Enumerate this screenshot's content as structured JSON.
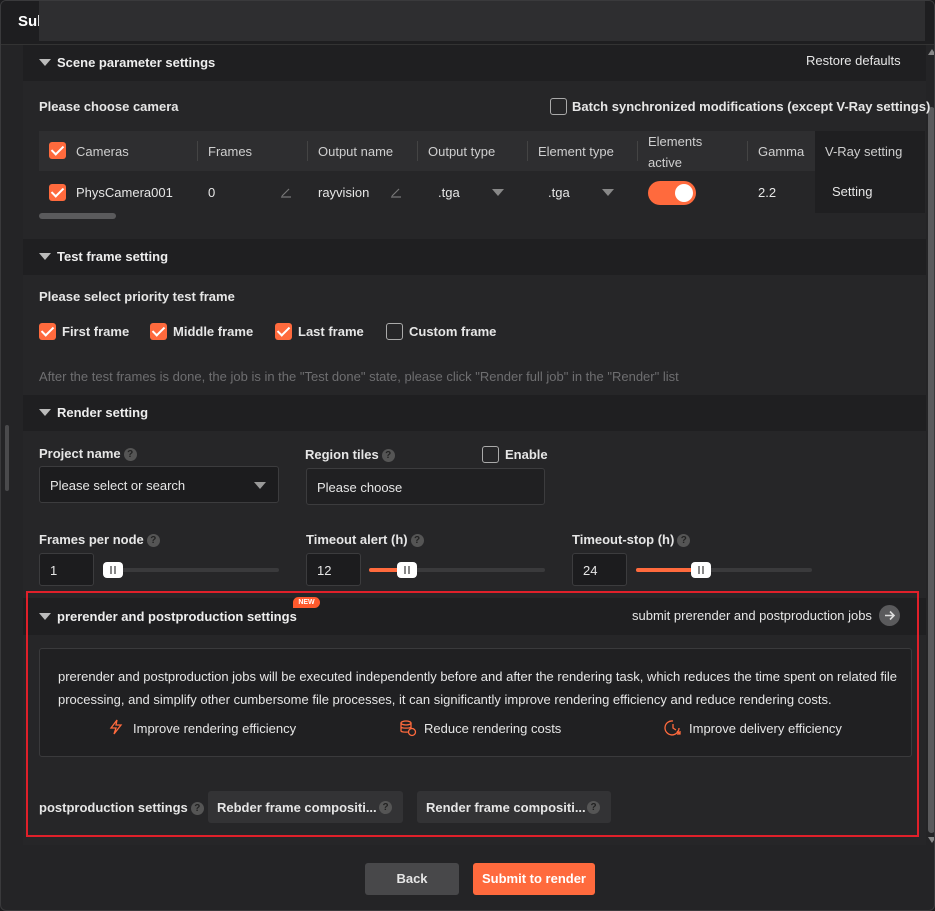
{
  "dialog": {
    "title": "Submit to render"
  },
  "scene": {
    "header": "Scene parameter settings",
    "restore_defaults": "Restore defaults",
    "choose_camera": "Please choose camera",
    "batch_label": "Batch synchronized modifications (except V-Ray settings)",
    "columns": {
      "cameras": "Cameras",
      "frames": "Frames",
      "output_name": "Output name",
      "output_type": "Output type",
      "element_type": "Element type",
      "elements_active_1": "Elements",
      "elements_active_2": "active",
      "gamma": "Gamma",
      "vray_setting": "V-Ray setting"
    },
    "row": {
      "camera": "PhysCamera001",
      "frames": "0",
      "output_name": "rayvision",
      "output_type": ".tga",
      "element_type": ".tga",
      "gamma": "2.2",
      "vray_setting": "Setting"
    }
  },
  "test_frame": {
    "header": "Test frame setting",
    "prompt": "Please select priority test frame",
    "options": {
      "first": "First frame",
      "middle": "Middle frame",
      "last": "Last frame",
      "custom": "Custom frame"
    },
    "note": "After the test frames is done, the job is in the \"Test done\" state, please click \"Render full job\" in the \"Render\" list"
  },
  "render": {
    "header": "Render setting",
    "project_name_label": "Project name",
    "project_name_placeholder": "Please select or search",
    "region_tiles_label": "Region tiles",
    "enable_label": "Enable",
    "region_tiles_placeholder": "Please choose",
    "frames_per_node_label": "Frames per node",
    "frames_per_node_value": "1",
    "timeout_alert_label": "Timeout alert (h)",
    "timeout_alert_value": "12",
    "timeout_stop_label": "Timeout-stop (h)",
    "timeout_stop_value": "24"
  },
  "prepost": {
    "header": "prerender and postproduction settings",
    "badge": "NEW",
    "submit_link": "submit prerender and postproduction jobs",
    "description": "prerender and postproduction jobs will be executed independently before and after the rendering task, which reduces the time spent on related file processing, and simplify other cumbersome file processes, it can significantly improve rendering efficiency and reduce rendering costs.",
    "features": {
      "efficiency": "Improve rendering efficiency",
      "costs": "Reduce rendering costs",
      "delivery": "Improve delivery efficiency"
    },
    "postproduction_label": "postproduction settings",
    "chips": {
      "chip1": "Rebder frame compositi...",
      "chip2": "Render frame compositi..."
    }
  },
  "footer": {
    "back": "Back",
    "submit": "Submit to render"
  },
  "colors": {
    "accent": "#ff6a3d",
    "highlight_border": "#e0202a"
  }
}
